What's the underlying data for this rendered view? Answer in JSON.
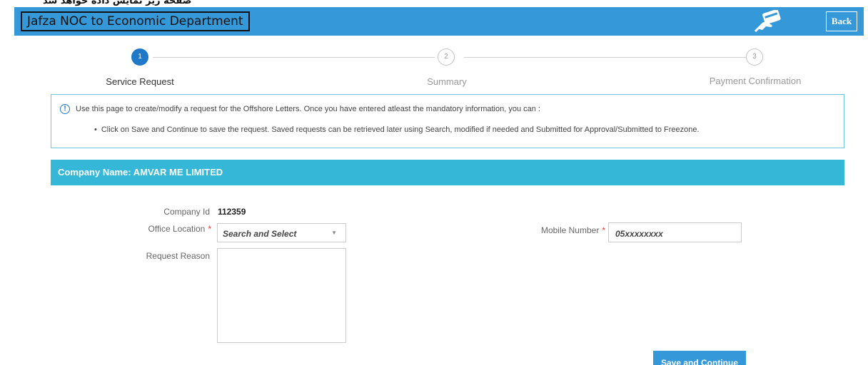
{
  "caption": "صفحه زیر نمایش داده خواهد شد",
  "header": {
    "title": "Jafza NOC to Economic Department",
    "back_label": "Back",
    "card_icon": "card-hand-icon"
  },
  "stepper": {
    "steps": [
      {
        "number": "1",
        "label": "Service Request",
        "state": "active"
      },
      {
        "number": "2",
        "label": "Summary",
        "state": "inactive"
      },
      {
        "number": "3",
        "label": "Payment Confirmation",
        "state": "inactive"
      }
    ]
  },
  "info": {
    "icon": "info-circle-icon",
    "text": "Use this page to create/modify a request for the Offshore Letters. Once you have entered atleast the mandatory information, you can :",
    "bullet": "Click on Save and Continue to save the request. Saved requests can be retrieved later using Search, modified if needed and Submitted for Approval/Submitted to Freezone."
  },
  "company": {
    "title": "Company Name: AMVAR ME LIMITED"
  },
  "form": {
    "company_id_label": "Company Id",
    "company_id_value": "112359",
    "office_location_label": "Office Location",
    "office_location_value": "Search and Select",
    "request_reason_label": "Request Reason",
    "mobile_label": "Mobile Number",
    "mobile_placeholder": "05xxxxxxxx",
    "required_mark": "*"
  },
  "actions": {
    "save_continue": "Save and Continue"
  },
  "colors": {
    "header_bg": "#3598d8",
    "company_bar": "#35b8d8",
    "step_active": "#1f78c8",
    "required": "#e33333"
  }
}
